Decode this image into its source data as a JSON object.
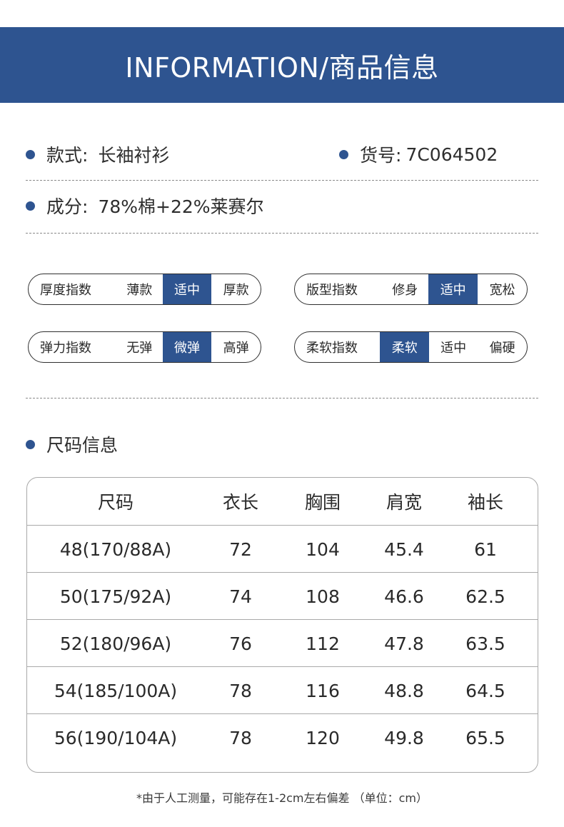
{
  "header": {
    "title": "INFORMATION/商品信息"
  },
  "info": {
    "style_label": "款式:",
    "style_value": "长袖衬衫",
    "sku_label": "货号:",
    "sku_value": "7C064502",
    "material_label": "成分:",
    "material_value": "78%棉+22%莱赛尔"
  },
  "scales": [
    {
      "label": "厚度指数",
      "options": [
        "薄款",
        "适中",
        "厚款"
      ],
      "selected": 1
    },
    {
      "label": "版型指数",
      "options": [
        "修身",
        "适中",
        "宽松"
      ],
      "selected": 1
    },
    {
      "label": "弹力指数",
      "options": [
        "无弹",
        "微弹",
        "高弹"
      ],
      "selected": 1
    },
    {
      "label": "柔软指数",
      "options": [
        "柔软",
        "适中",
        "偏硬"
      ],
      "selected": 0
    }
  ],
  "colors": {
    "accent": "#2e5490"
  },
  "size_section": {
    "title": "尺码信息",
    "headers": [
      "尺码",
      "衣长",
      "胸围",
      "肩宽",
      "袖长"
    ],
    "rows": [
      [
        "48(170/88A)",
        "72",
        "104",
        "45.4",
        "61"
      ],
      [
        "50(175/92A)",
        "74",
        "108",
        "46.6",
        "62.5"
      ],
      [
        "52(180/96A)",
        "76",
        "112",
        "47.8",
        "63.5"
      ],
      [
        "54(185/100A)",
        "78",
        "116",
        "48.8",
        "64.5"
      ],
      [
        "56(190/104A)",
        "78",
        "120",
        "49.8",
        "65.5"
      ]
    ]
  },
  "footnote": "*由于人工测量，可能存在1-2cm左右偏差 （单位：cm）"
}
